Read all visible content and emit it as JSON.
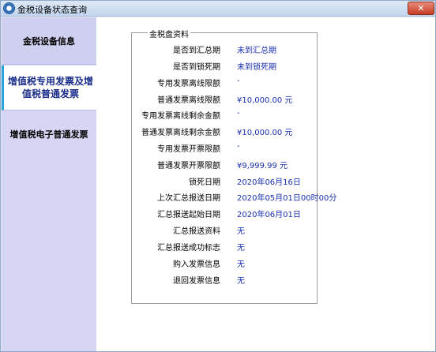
{
  "window": {
    "title": "金税设备状态查询",
    "close_label": "✕"
  },
  "sidebar": {
    "tabs": [
      {
        "label": "金税设备信息"
      },
      {
        "label_line1": "增值税专用发票及增",
        "label_line2": "值税普通发票"
      },
      {
        "label": "增值税电子普通发票"
      }
    ]
  },
  "group": {
    "legend": "金税盘资料",
    "rows": [
      {
        "label": "是否到汇总期",
        "value": "未到汇总期"
      },
      {
        "label": "是否到锁死期",
        "value": "未到锁死期"
      },
      {
        "label": "专用发票离线限额",
        "value": "-"
      },
      {
        "label": "普通发票离线限额",
        "value": "¥10,000.00 元"
      },
      {
        "label": "专用发票离线剩余金额",
        "value": "-"
      },
      {
        "label": "普通发票离线剩余金额",
        "value": "¥10,000.00 元"
      },
      {
        "label": "专用发票开票限额",
        "value": "-"
      },
      {
        "label": "普通发票开票限额",
        "value": "¥9,999.99 元"
      },
      {
        "label": "锁死日期",
        "value": "2020年06月16日"
      },
      {
        "label": "上次汇总报送日期",
        "value": "2020年05月01日00时00分"
      },
      {
        "label": "汇总报送起始日期",
        "value": "2020年06月01日"
      },
      {
        "label": "汇总报送资料",
        "value": "无"
      },
      {
        "label": "汇总报送成功标志",
        "value": "无"
      },
      {
        "label": "购入发票信息",
        "value": "无"
      },
      {
        "label": "退回发票信息",
        "value": "无"
      }
    ]
  }
}
